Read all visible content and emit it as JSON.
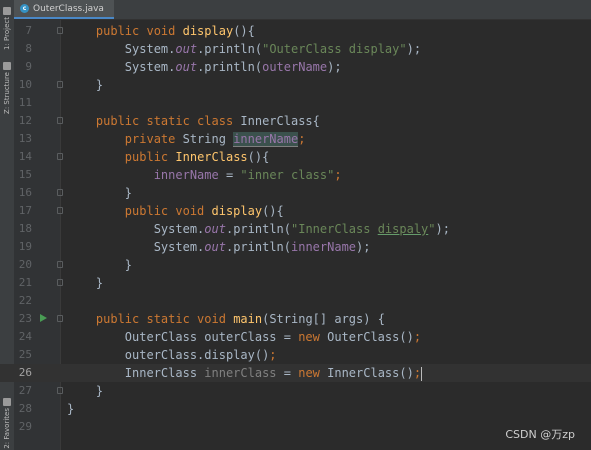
{
  "sidebar": {
    "project_label": "1: Project",
    "structure_label": "Z: Structure",
    "favorites_label": "2: Favorites"
  },
  "tab": {
    "label": "OuterClass.java",
    "icon": "class-c-icon"
  },
  "lines": [
    {
      "num": "7",
      "tokens": [
        [
          "kw",
          "public void "
        ],
        [
          "fn",
          "display"
        ],
        [
          "",
          "(){"
        ]
      ]
    },
    {
      "num": "8",
      "tokens": [
        [
          "",
          "    System."
        ],
        [
          "it",
          "out"
        ],
        [
          "",
          ".println("
        ],
        [
          "str",
          "\"OuterClass display\""
        ],
        [
          "",
          ");"
        ]
      ]
    },
    {
      "num": "9",
      "tokens": [
        [
          "",
          "    System."
        ],
        [
          "it",
          "out"
        ],
        [
          "",
          ".println("
        ],
        [
          "fld",
          "outerName"
        ],
        [
          "",
          ");"
        ]
      ]
    },
    {
      "num": "10",
      "tokens": [
        [
          "",
          "}"
        ]
      ]
    },
    {
      "num": "11",
      "tokens": []
    },
    {
      "num": "12",
      "tokens": [
        [
          "kw",
          "public static class "
        ],
        [
          "",
          "InnerClass{"
        ]
      ]
    },
    {
      "num": "13",
      "tokens": [
        [
          "kw",
          "    private "
        ],
        [
          "",
          "String "
        ],
        [
          "fld hl",
          "innerName"
        ],
        [
          "kw",
          ";"
        ]
      ]
    },
    {
      "num": "14",
      "tokens": [
        [
          "kw",
          "    public "
        ],
        [
          "fn",
          "InnerClass"
        ],
        [
          "",
          "(){"
        ]
      ]
    },
    {
      "num": "15",
      "tokens": [
        [
          "fld",
          "        innerName"
        ],
        [
          "",
          " = "
        ],
        [
          "str",
          "\"inner class\""
        ],
        [
          "kw",
          ";"
        ]
      ]
    },
    {
      "num": "16",
      "tokens": [
        [
          "",
          "    }"
        ]
      ]
    },
    {
      "num": "17",
      "tokens": [
        [
          "kw",
          "    public void "
        ],
        [
          "fn",
          "display"
        ],
        [
          "",
          "(){"
        ]
      ]
    },
    {
      "num": "18",
      "tokens": [
        [
          "",
          "        System."
        ],
        [
          "it",
          "out"
        ],
        [
          "",
          ".println("
        ],
        [
          "str",
          "\"InnerClass "
        ],
        [
          "str typo",
          "dispaly"
        ],
        [
          "str",
          "\""
        ],
        [
          "",
          ");"
        ]
      ]
    },
    {
      "num": "19",
      "tokens": [
        [
          "",
          "        System."
        ],
        [
          "it",
          "out"
        ],
        [
          "",
          ".println("
        ],
        [
          "fld",
          "innerName"
        ],
        [
          "",
          ");"
        ]
      ]
    },
    {
      "num": "20",
      "tokens": [
        [
          "",
          "    }"
        ]
      ]
    },
    {
      "num": "21",
      "tokens": [
        [
          "",
          "}"
        ]
      ]
    },
    {
      "num": "22",
      "tokens": []
    },
    {
      "num": "23",
      "tokens": [
        [
          "kw",
          "public static void "
        ],
        [
          "fn",
          "main"
        ],
        [
          "",
          "(String[] args) {"
        ]
      ]
    },
    {
      "num": "24",
      "tokens": [
        [
          "",
          "    OuterClass outerClass = "
        ],
        [
          "kw",
          "new "
        ],
        [
          "",
          "OuterClass()"
        ],
        [
          "kw",
          ";"
        ]
      ]
    },
    {
      "num": "25",
      "tokens": [
        [
          "",
          "    outerClass.display()"
        ],
        [
          "kw",
          ";"
        ]
      ]
    },
    {
      "num": "26",
      "tokens": [
        [
          "",
          "    InnerClass "
        ],
        [
          "unused",
          "innerClass"
        ],
        [
          "",
          " = "
        ],
        [
          "kw",
          "new "
        ],
        [
          "",
          "InnerClass()"
        ],
        [
          "kw",
          ";"
        ]
      ]
    },
    {
      "num": "27",
      "tokens": [
        [
          "",
          "}"
        ]
      ]
    },
    {
      "num": "28",
      "tokens": [
        [
          "",
          "}"
        ]
      ]
    },
    {
      "num": "29",
      "tokens": []
    }
  ],
  "watermark": "CSDN @万zp"
}
